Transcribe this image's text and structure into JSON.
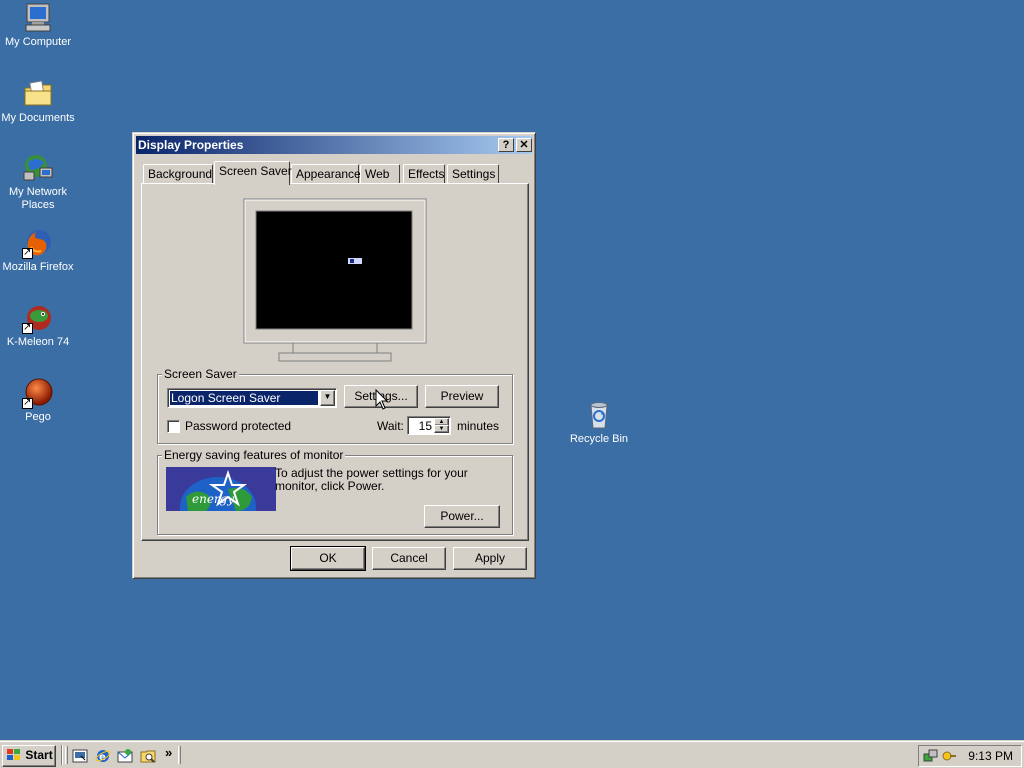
{
  "desktop": {
    "icons": [
      {
        "label": "My Computer",
        "icon": "my-computer-icon"
      },
      {
        "label": "My Documents",
        "icon": "folder-documents-icon"
      },
      {
        "label": "My Network Places",
        "icon": "network-places-icon"
      },
      {
        "label": "Mozilla Firefox",
        "icon": "firefox-icon"
      },
      {
        "label": "K-Meleon 74",
        "icon": "k-meleon-icon"
      },
      {
        "label": "Pego",
        "icon": "pego-icon"
      },
      {
        "label": "Recycle Bin",
        "icon": "recycle-bin-icon"
      }
    ],
    "background_color": "#3a6ea5"
  },
  "window": {
    "title": "Display Properties",
    "help_label": "?",
    "close_label": "✕",
    "tabs": [
      {
        "label": "Background",
        "active": false
      },
      {
        "label": "Screen Saver",
        "active": true
      },
      {
        "label": "Appearance",
        "active": false
      },
      {
        "label": "Web",
        "active": false
      },
      {
        "label": "Effects",
        "active": false
      },
      {
        "label": "Settings",
        "active": false
      }
    ],
    "screen_saver": {
      "group_title": "Screen Saver",
      "selected": "Logon Screen Saver",
      "settings_label": "Settings...",
      "preview_label": "Preview",
      "password_label": "Password protected",
      "password_checked": false,
      "wait_label": "Wait:",
      "wait_value": "15",
      "minutes_label": "minutes"
    },
    "energy": {
      "group_title": "Energy saving features of monitor",
      "text": "To adjust the power settings for your monitor, click Power.",
      "power_label": "Power...",
      "logo_text": "energy"
    },
    "buttons": {
      "ok": "OK",
      "cancel": "Cancel",
      "apply": "Apply"
    }
  },
  "taskbar": {
    "start_label": "Start",
    "chevron": "»",
    "clock": "9:13 PM",
    "quick_launch": [
      "show-desktop-icon",
      "internet-explorer-icon",
      "outlook-express-icon",
      "explorer-icon"
    ]
  },
  "colors": {
    "title_gradient_start": "#0a246a",
    "title_gradient_end": "#a6caf0",
    "face": "#d4d0c8",
    "selection": "#0a246a"
  }
}
